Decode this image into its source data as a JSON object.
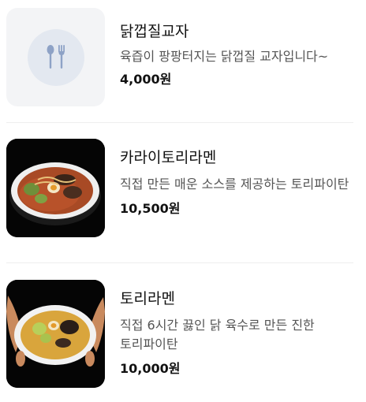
{
  "menu_items": [
    {
      "name": "닭껍질교자",
      "description": "육즙이 팡팡터지는 닭껍질 교자입니다~",
      "price": "4,000원",
      "thumbnail": "placeholder",
      "icon": "fork-spoon-icon"
    },
    {
      "name": "카라이토리라멘",
      "description": "직접 만든 매운 소스를 제공하는 토리파이탄",
      "price": "10,500원",
      "thumbnail": "photo-spicy-ramen"
    },
    {
      "name": "토리라멘",
      "description": "직접 6시간 끓인 닭 육수로 만든 진한 토리파이탄",
      "price": "10,000원",
      "thumbnail": "photo-chicken-ramen"
    }
  ],
  "colors": {
    "placeholder_bg": "#f3f4f6",
    "placeholder_circle": "#e3e8f0",
    "placeholder_icon": "#8ea2c6",
    "broth_spicy": "#b8522a",
    "broth_clear": "#d9a53c"
  }
}
